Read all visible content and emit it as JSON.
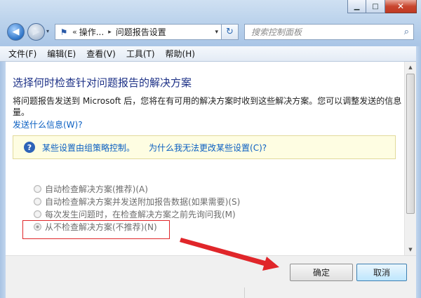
{
  "window": {
    "minimize_glyph": "▁",
    "maximize_glyph": "□",
    "close_glyph": "✕"
  },
  "navigation": {
    "back_glyph": "◀",
    "forward_glyph": "▶",
    "history_glyph": "▾"
  },
  "address": {
    "chevron": "«",
    "crumb1": "操作...",
    "separator": "▸",
    "crumb2": "问题报告设置",
    "dropdown_glyph": "▾",
    "refresh_glyph": "↻"
  },
  "search": {
    "placeholder": "搜索控制面板",
    "icon_glyph": "⌕"
  },
  "menu": [
    {
      "label": "文件(F)"
    },
    {
      "label": "编辑(E)"
    },
    {
      "label": "查看(V)"
    },
    {
      "label": "工具(T)"
    },
    {
      "label": "帮助(H)"
    }
  ],
  "content": {
    "heading": "选择何时检查针对问题报告的解决方案",
    "description": "将问题报告发送到 Microsoft 后，您将在有可用的解决方案时收到这些解决方案。您可以调整发送的信息量。",
    "link_what": "发送什么信息(W)?",
    "info_icon_glyph": "?",
    "info_text": "某些设置由组策略控制。",
    "info_link": "为什么我无法更改某些设置(C)?"
  },
  "options": [
    {
      "label": "自动检查解决方案(推荐)(A)",
      "checked": false
    },
    {
      "label": "自动检查解决方案并发送附加报告数据(如果需要)(S)",
      "checked": false
    },
    {
      "label": "每次发生问题时，在检查解决方案之前先询问我(M)",
      "checked": false
    },
    {
      "label": "从不检查解决方案(不推荐)(N)",
      "checked": true
    }
  ],
  "scrollbar": {
    "up_glyph": "▲",
    "down_glyph": "▼"
  },
  "buttons": {
    "ok_label": "确定",
    "cancel_label": "取消"
  },
  "colors": {
    "heading": "#1e3287",
    "link": "#0a5fc2",
    "annotation_red": "#e0262a"
  }
}
